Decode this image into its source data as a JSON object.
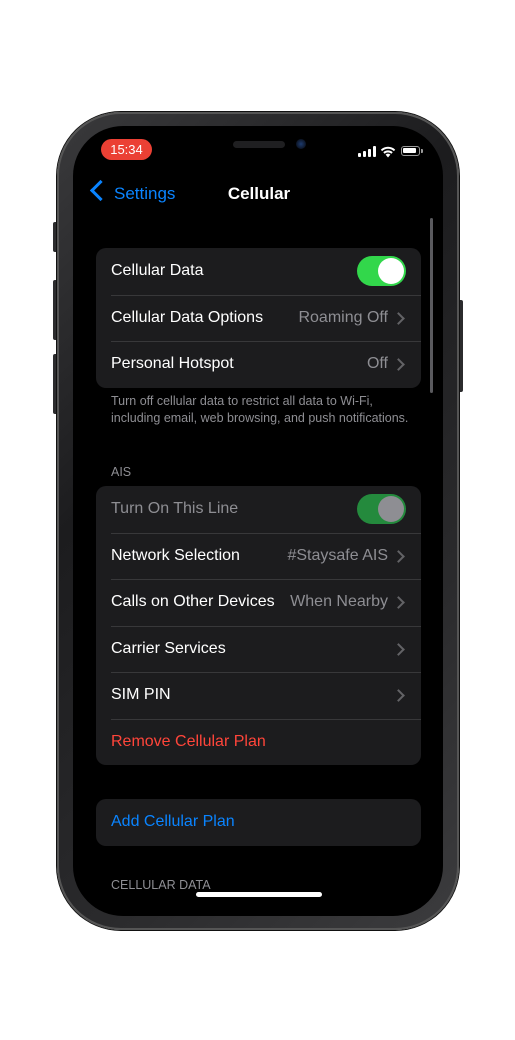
{
  "status_bar": {
    "time": "15:34",
    "accent_time_bg": "#eb4034"
  },
  "nav": {
    "back_label": "Settings",
    "title": "Cellular"
  },
  "group_main": {
    "rows": [
      {
        "label": "Cellular Data",
        "toggle": true
      },
      {
        "label": "Cellular Data Options",
        "value": "Roaming Off"
      },
      {
        "label": "Personal Hotspot",
        "value": "Off"
      }
    ]
  },
  "footnote": "Turn off cellular data to restrict all data to Wi-Fi, including email, web browsing, and push notifications.",
  "line_section": {
    "header": "AIS",
    "rows": [
      {
        "label": "Turn On This Line",
        "toggle": true,
        "disabled": true
      },
      {
        "label": "Network Selection",
        "value": "#Staysafe AIS"
      },
      {
        "label": "Calls on Other Devices",
        "value": "When Nearby"
      },
      {
        "label": "Carrier Services"
      },
      {
        "label": "SIM PIN"
      },
      {
        "label": "Remove Cellular Plan",
        "destructive": true
      }
    ]
  },
  "add_plan": {
    "label": "Add Cellular Plan"
  },
  "cellular_data_header": "CELLULAR DATA",
  "colors": {
    "accent_blue": "#0a84ff",
    "toggle_green": "#32d74b",
    "destructive_red": "#ff453a",
    "group_bg": "#1c1c1e"
  }
}
